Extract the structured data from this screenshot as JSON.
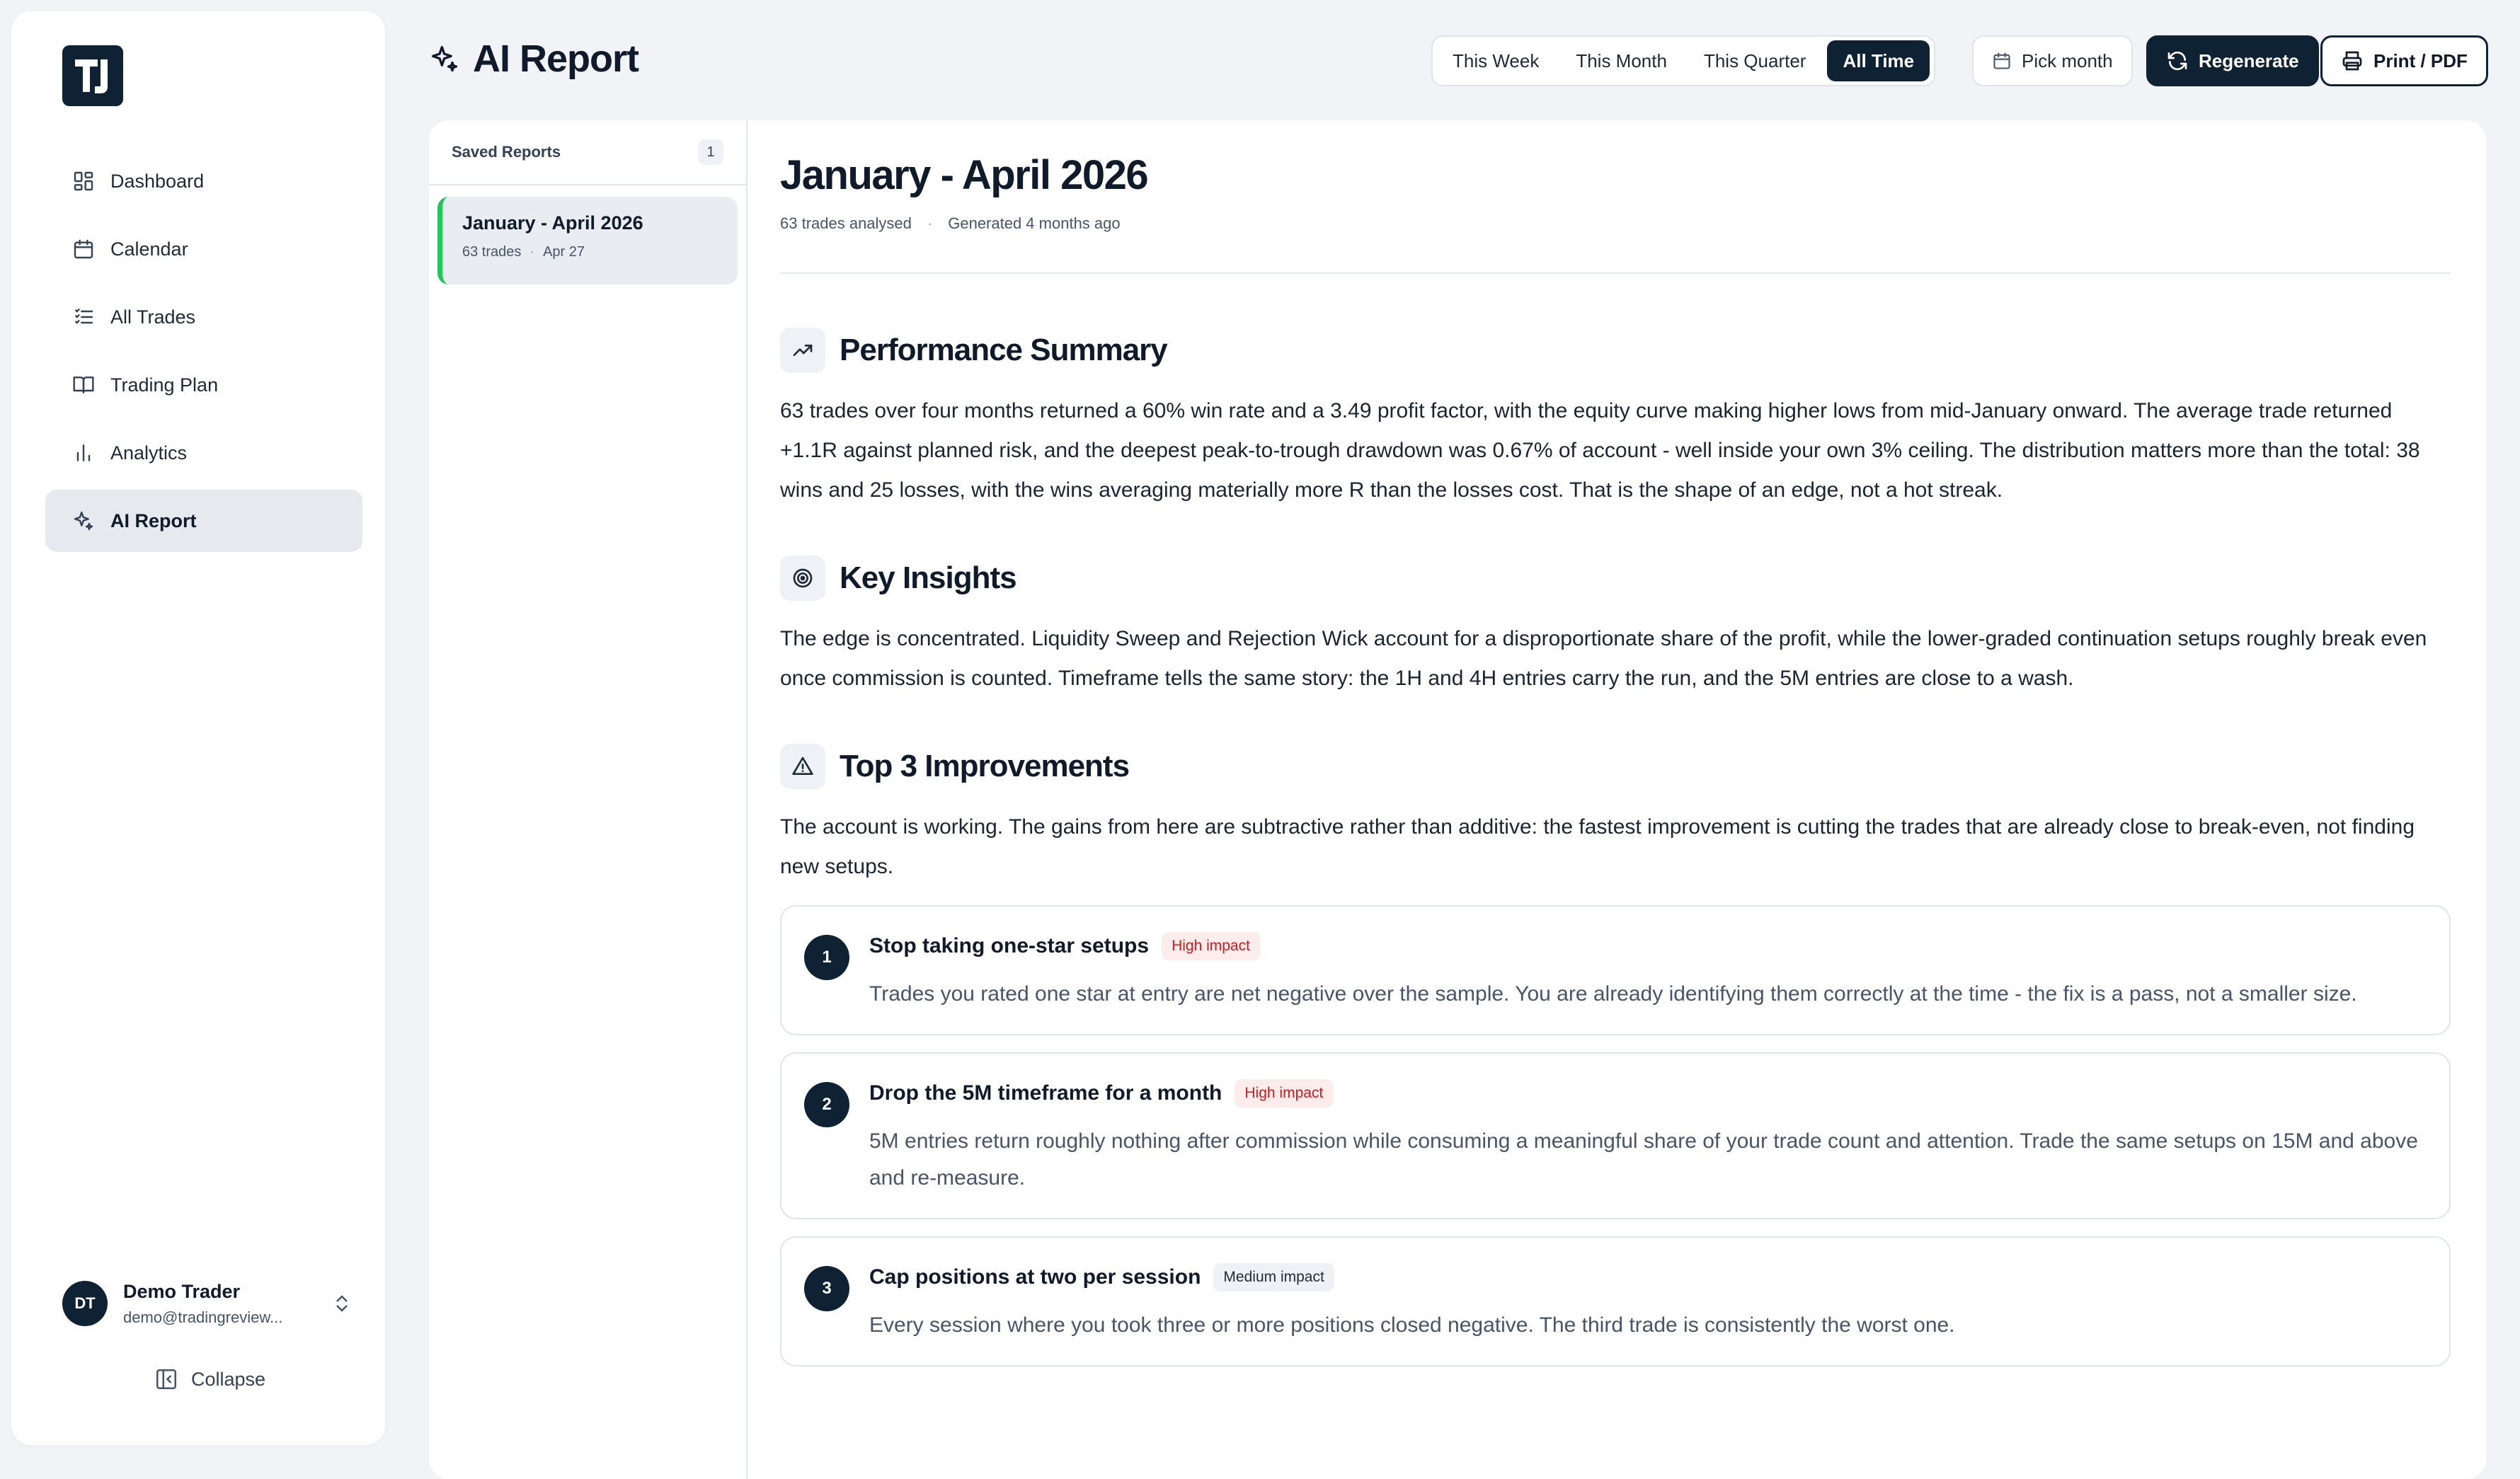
{
  "sidebar": {
    "logo_text": "TJ",
    "items": [
      {
        "label": "Dashboard",
        "icon": "dashboard-icon"
      },
      {
        "label": "Calendar",
        "icon": "calendar-icon"
      },
      {
        "label": "All Trades",
        "icon": "list-icon"
      },
      {
        "label": "Trading Plan",
        "icon": "book-icon"
      },
      {
        "label": "Analytics",
        "icon": "bar-chart-icon"
      },
      {
        "label": "AI Report",
        "icon": "sparkles-icon",
        "active": true
      }
    ],
    "user": {
      "initials": "DT",
      "name": "Demo Trader",
      "email": "demo@tradingreview..."
    },
    "collapse_label": "Collapse"
  },
  "header": {
    "title": "AI Report",
    "ranges": [
      "This Week",
      "This Month",
      "This Quarter",
      "All Time"
    ],
    "active_range": "All Time",
    "pick_month": "Pick month",
    "regenerate": "Regenerate",
    "print": "Print / PDF"
  },
  "saved": {
    "title": "Saved Reports",
    "count": "1",
    "items": [
      {
        "title": "January - April 2026",
        "trades": "63 trades",
        "date": "Apr 27"
      }
    ]
  },
  "report": {
    "title": "January - April 2026",
    "meta_trades": "63 trades analysed",
    "meta_separator": "·",
    "meta_generated": "Generated 4 months ago",
    "sections": {
      "performance": {
        "title": "Performance Summary",
        "body": "63 trades over four months returned a 60% win rate and a 3.49 profit factor, with the equity curve making higher lows from mid-January onward. The average trade returned +1.1R against planned risk, and the deepest peak-to-trough drawdown was 0.67% of account - well inside your own 3% ceiling. The distribution matters more than the total: 38 wins and 25 losses, with the wins averaging materially more R than the losses cost. That is the shape of an edge, not a hot streak."
      },
      "insights": {
        "title": "Key Insights",
        "body": "The edge is concentrated. Liquidity Sweep and Rejection Wick account for a disproportionate share of the profit, while the lower-graded continuation setups roughly break even once commission is counted. Timeframe tells the same story: the 1H and 4H entries carry the run, and the 5M entries are close to a wash."
      },
      "improvements": {
        "title": "Top 3 Improvements",
        "body": "The account is working. The gains from here are subtractive rather than additive: the fastest improvement is cutting the trades that are already close to break-even, not finding new setups.",
        "items": [
          {
            "num": "1",
            "title": "Stop taking one-star setups",
            "impact": "High impact",
            "desc": "Trades you rated one star at entry are net negative over the sample. You are already identifying them correctly at the time - the fix is a pass, not a smaller size."
          },
          {
            "num": "2",
            "title": "Drop the 5M timeframe for a month",
            "impact": "High impact",
            "desc": "5M entries return roughly nothing after commission while consuming a meaningful share of your trade count and attention. Trade the same setups on 15M and above and re-measure."
          },
          {
            "num": "3",
            "title": "Cap positions at two per session",
            "impact": "Medium impact",
            "desc": "Every session where you took three or more positions closed negative. The third trade is consistently the worst one."
          }
        ]
      }
    }
  },
  "colors": {
    "primary": "#0f2233",
    "accent_green": "#22c55e",
    "high_impact": "#c81e1e",
    "background": "#f1f3f6"
  }
}
